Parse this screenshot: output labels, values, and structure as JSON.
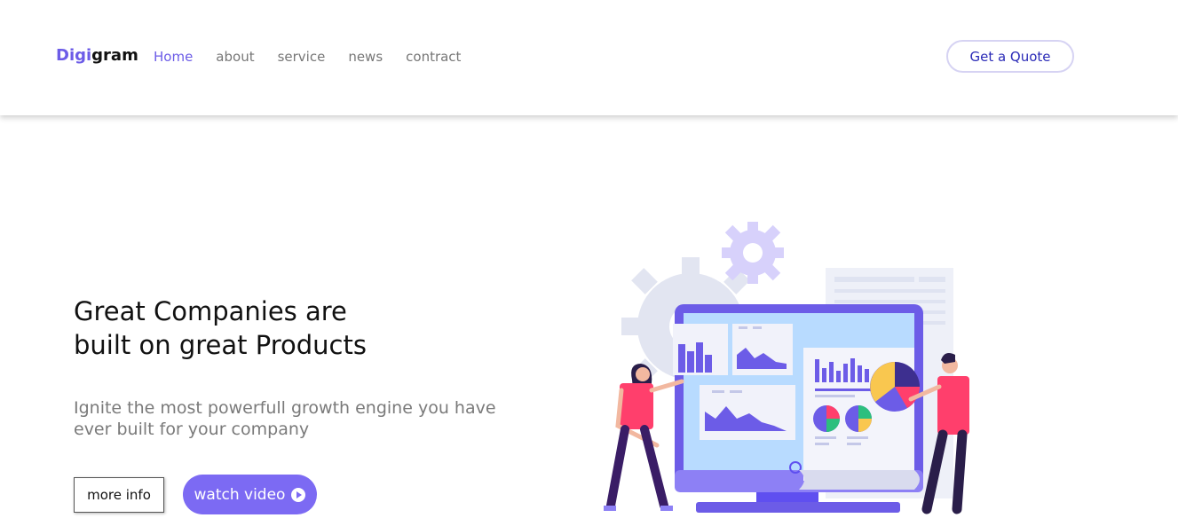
{
  "header": {
    "logo_accent": "Digi",
    "logo_rest": "gram",
    "nav": [
      "Home",
      "about",
      "service",
      "news",
      "contract"
    ],
    "quote_button": "Get a Quote"
  },
  "hero": {
    "title_line1": "Great Companies are",
    "title_line2": "built on great Products",
    "subtitle": "Ignite the most powerfull growth engine you have ever built for your company",
    "more_info_label": "more info",
    "watch_video_label": "watch video",
    "play_icon": "play-circle-icon"
  },
  "illustration": {
    "name": "analytics-dashboard-illustration",
    "colors": {
      "accent": "#6c5ce7",
      "pink": "#ff3f6c",
      "yellow": "#f9c74f",
      "gear": "#dde1f0"
    }
  }
}
